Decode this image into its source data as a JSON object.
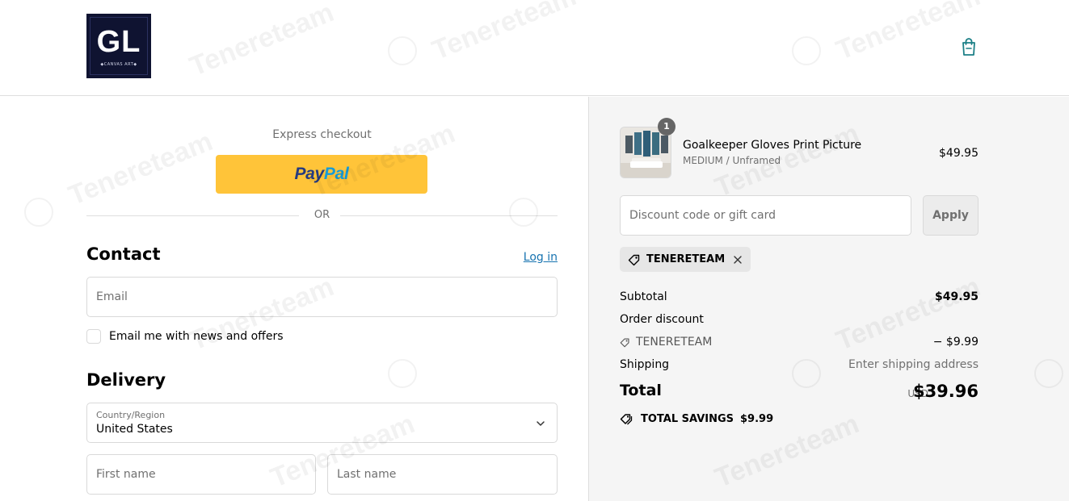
{
  "header": {
    "logo_text": "GL",
    "logo_subtext": "◆CANVAS ART◆",
    "cart_icon": "shopping-bag-icon"
  },
  "express": {
    "label": "Express checkout",
    "paypal_dark": "Pay",
    "paypal_light": "Pal",
    "or_text": "OR"
  },
  "contact": {
    "title": "Contact",
    "login_label": "Log in",
    "email_placeholder": "Email",
    "newsletter_label": "Email me with news and offers"
  },
  "delivery": {
    "title": "Delivery",
    "country_caption": "Country/Region",
    "country_value": "United States",
    "first_name_placeholder": "First name",
    "last_name_placeholder": "Last name"
  },
  "order": {
    "item": {
      "quantity": "1",
      "name": "Goalkeeper Gloves Print Picture",
      "variant": "MEDIUM / Unframed",
      "price": "$49.95"
    },
    "discount_placeholder": "Discount code or gift card",
    "apply_label": "Apply",
    "applied_code": "TENERETEAM",
    "subtotal_label": "Subtotal",
    "subtotal_value": "$49.95",
    "order_discount_label": "Order discount",
    "discount_code_label": "TENERETEAM",
    "discount_value": "− $9.99",
    "shipping_label": "Shipping",
    "shipping_value": "Enter shipping address",
    "total_label": "Total",
    "currency": "USD",
    "total_value": "$39.96",
    "savings_label": "TOTAL SAVINGS",
    "savings_value": "$9.99"
  },
  "watermark": {
    "text": "Tenereteam"
  },
  "colors": {
    "paypal_yellow": "#ffc439",
    "link_blue": "#1773b0",
    "cart_teal": "#1b7f86",
    "logo_navy": "#0f1331",
    "summary_bg": "#f5f5f5"
  }
}
